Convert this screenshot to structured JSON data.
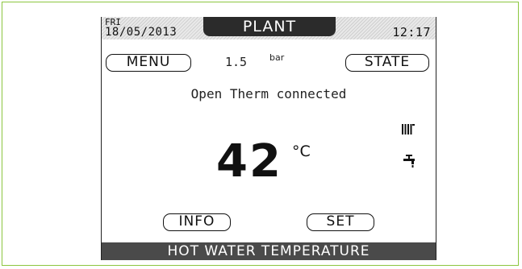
{
  "header": {
    "day": "FRI",
    "date": "18/05/2013",
    "title": "PLANT",
    "time": "12:17"
  },
  "controls": {
    "menu_label": "MENU",
    "state_label": "STATE",
    "info_label": "INFO",
    "set_label": "SET"
  },
  "pressure": {
    "value": "1.5",
    "unit": "bar"
  },
  "status_message": "Open Therm connected",
  "temperature": {
    "value": "42",
    "unit": "°C"
  },
  "indicators": [
    "radiator-icon",
    "tap-icon"
  ],
  "footer_label": "HOT WATER TEMPERATURE",
  "colors": {
    "frame_border": "#8cc63f",
    "header_tab": "#2b2b2b",
    "footer_bar": "#4a4a4a"
  }
}
